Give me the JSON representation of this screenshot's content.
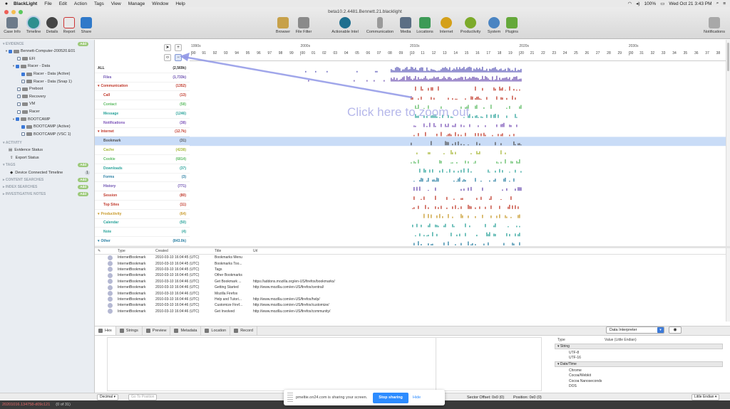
{
  "menubar": {
    "app": "BlackLight",
    "items": [
      "File",
      "Edit",
      "Action",
      "Tags",
      "View",
      "Manage",
      "Window",
      "Help"
    ],
    "battery": "100%",
    "clock": "Wed Oct 21  3:43 PM"
  },
  "window": {
    "title": "beta10.2.4481.Bennett.21.blacklight"
  },
  "toolbar": {
    "left": [
      "Case Info",
      "Timeline",
      "Details",
      "Report",
      "Share"
    ],
    "center": [
      "Browser",
      "File Filter",
      "Actionable Intel",
      "Communication",
      "Media",
      "Locations",
      "Internet",
      "Productivity",
      "System",
      "Plugins"
    ],
    "right": "Notifications"
  },
  "sidebar": {
    "evidence_header": "EVIDENCE",
    "add_label": "Add",
    "evidence": [
      "Bennett-Computer-200520.E01",
      "EFI",
      "Racer - Data",
      "Racer - Data (Active)",
      "Racer - Data (Snap 1)",
      "Preboot",
      "Recovery",
      "VM",
      "Racer",
      "BOOTCAMP",
      "BOOTCAMP (Active)",
      "BOOTCAMP (VSC 1)"
    ],
    "activity_header": "ACTIVITY",
    "activity": [
      "Evidence Status",
      "Export Status"
    ],
    "tags_header": "TAGS",
    "tags": [
      "Device Connected Timeline"
    ],
    "tags_count": "1",
    "content_searches": "CONTENT SEARCHES",
    "index_searches": "INDEX SEARCHES",
    "investigative_notes": "INVESTIGATIVE NOTES"
  },
  "timeline": {
    "decades": [
      "1990s",
      "2000s",
      "2010s",
      "2020s",
      "2030s"
    ],
    "years": [
      "90",
      "91",
      "92",
      "93",
      "94",
      "95",
      "96",
      "97",
      "98",
      "99",
      "00",
      "01",
      "02",
      "03",
      "04",
      "05",
      "06",
      "07",
      "08",
      "09",
      "10",
      "11",
      "12",
      "13",
      "14",
      "15",
      "16",
      "17",
      "18",
      "19",
      "20",
      "21",
      "22",
      "23",
      "24",
      "25",
      "26",
      "27",
      "28",
      "29",
      "30",
      "31",
      "32",
      "33",
      "34",
      "35",
      "36",
      "37",
      "38"
    ],
    "zoom_in": "+",
    "zoom_out": "−",
    "callout": "Click here to zoom out",
    "categories": [
      {
        "label": "ALL",
        "count": "(2,569k)",
        "head": true,
        "color": "#333"
      },
      {
        "label": "Files",
        "count": "(1,733k)",
        "head": false,
        "color": "#6b4fb0"
      },
      {
        "label": "Communication",
        "count": "(1352)",
        "head": true,
        "color": "#c0392b"
      },
      {
        "label": "Call",
        "count": "(13)",
        "head": false,
        "color": "#c0392b"
      },
      {
        "label": "Contact",
        "count": "(58)",
        "head": false,
        "color": "#5dbb63"
      },
      {
        "label": "Message",
        "count": "(1246)",
        "head": false,
        "color": "#2aa39a"
      },
      {
        "label": "Notifications",
        "count": "(38)",
        "head": false,
        "color": "#7b52b8"
      },
      {
        "label": "Internet",
        "count": "(12.7k)",
        "head": true,
        "color": "#c0392b"
      },
      {
        "label": "Bookmark",
        "count": "(31)",
        "head": false,
        "color": "#555",
        "selected": true
      },
      {
        "label": "Cache",
        "count": "(4238)",
        "head": false,
        "color": "#a8b838"
      },
      {
        "label": "Cookie",
        "count": "(6814)",
        "head": false,
        "color": "#5dbb63"
      },
      {
        "label": "Downloads",
        "count": "(37)",
        "head": false,
        "color": "#2aa39a"
      },
      {
        "label": "Forms",
        "count": "(3)",
        "head": false,
        "color": "#2a7fa3"
      },
      {
        "label": "History",
        "count": "(771)",
        "head": false,
        "color": "#6b4fb0"
      },
      {
        "label": "Session",
        "count": "(80)",
        "head": false,
        "color": "#c0392b"
      },
      {
        "label": "Top Sites",
        "count": "(11)",
        "head": false,
        "color": "#c0392b"
      },
      {
        "label": "Productivity",
        "count": "(64)",
        "head": true,
        "color": "#c89a2a"
      },
      {
        "label": "Calendar",
        "count": "(50)",
        "head": false,
        "color": "#2aa39a"
      },
      {
        "label": "Note",
        "count": "(4)",
        "head": false,
        "color": "#2aa39a"
      },
      {
        "label": "Other",
        "count": "(843.0k)",
        "head": true,
        "color": "#2a7fa3"
      }
    ]
  },
  "results": {
    "headers": {
      "type": "Type",
      "created": "Created",
      "title": "Title",
      "url": "Url"
    },
    "rows": [
      {
        "type": "InternetBookmark",
        "created": "2010-03-10 16:04:45 (UTC)",
        "title": "Bookmarks Menu",
        "url": ""
      },
      {
        "type": "InternetBookmark",
        "created": "2010-03-10 16:04:45 (UTC)",
        "title": "Bookmarks Too...",
        "url": ""
      },
      {
        "type": "InternetBookmark",
        "created": "2010-03-10 16:04:45 (UTC)",
        "title": "Tags",
        "url": ""
      },
      {
        "type": "InternetBookmark",
        "created": "2010-03-10 16:04:45 (UTC)",
        "title": "Other Bookmarks",
        "url": ""
      },
      {
        "type": "InternetBookmark",
        "created": "2010-03-10 16:04:46 (UTC)",
        "title": "Get Bookmark ...",
        "url": "https://addons.mozilla.org/en-US/firefox/bookmarks/"
      },
      {
        "type": "InternetBookmark",
        "created": "2010-03-10 16:04:46 (UTC)",
        "title": "Getting Started",
        "url": "http://www.mozilla.com/en-US/firefox/central/"
      },
      {
        "type": "InternetBookmark",
        "created": "2010-03-10 16:04:46 (UTC)",
        "title": "Mozilla Firefox",
        "url": ""
      },
      {
        "type": "InternetBookmark",
        "created": "2010-03-10 16:04:46 (UTC)",
        "title": "Help and Tutori...",
        "url": "http://www.mozilla.com/en-US/firefox/help/"
      },
      {
        "type": "InternetBookmark",
        "created": "2010-03-10 16:04:46 (UTC)",
        "title": "Customize Firef...",
        "url": "http://www.mozilla.com/en-US/firefox/customize/"
      },
      {
        "type": "InternetBookmark",
        "created": "2010-03-10 16:04:46 (UTC)",
        "title": "Get Involved",
        "url": "http://www.mozilla.com/en-US/firefox/community/"
      }
    ]
  },
  "bottom_tabs": [
    "Hex",
    "Strings",
    "Preview",
    "Metadata",
    "Location",
    "Record"
  ],
  "interpreter": {
    "select": "Data Interpreter",
    "col_type": "Type",
    "col_value": "Value (Little Endian)",
    "groups": [
      {
        "name": "String",
        "items": [
          "UTF-8",
          "UTF-16"
        ]
      },
      {
        "name": "Date/Time",
        "items": [
          "Chrome",
          "Cocoa/Webkit",
          "Cocoa Nanoseconds",
          "DOS"
        ]
      }
    ]
  },
  "statusbar": {
    "decimal": "Decimal",
    "go_to_position": "Go To Position",
    "sector_offset": "Sector Offset: 0x0 (0)",
    "position": "Position: 0x0 (0)",
    "endian": "Little Endian"
  },
  "bottombar": {
    "id": "20201016.134758-d09c121",
    "count": "(0 of 31)"
  },
  "share_banner": {
    "text": "pmeltie.on24.com is sharing your screen.",
    "stop": "Stop sharing",
    "hide": "Hide"
  }
}
